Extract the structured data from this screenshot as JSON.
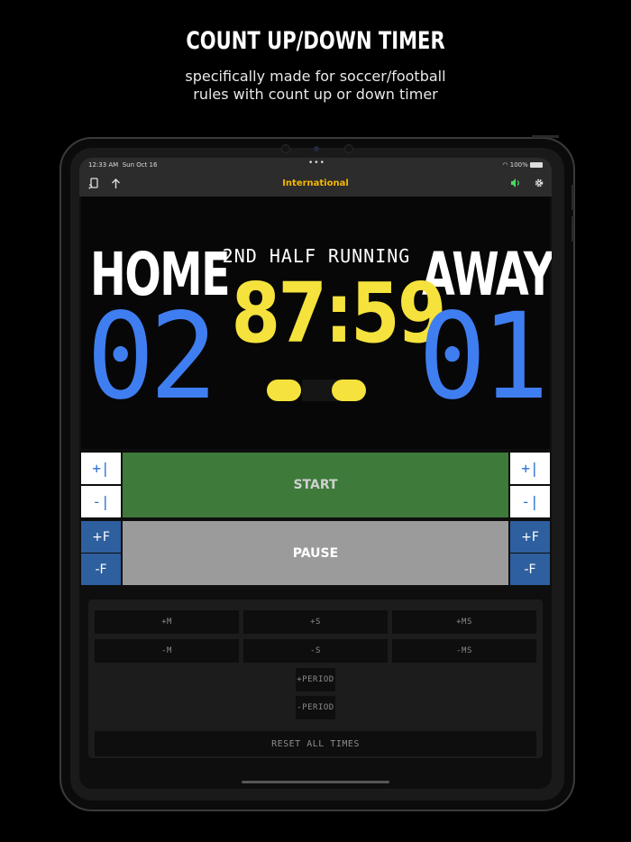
{
  "promo": {
    "title": "COUNT UP/DOWN TIMER",
    "subtitle_line1": "specifically made for soccer/football",
    "subtitle_line2": "rules with count up or down timer"
  },
  "status_bar": {
    "time": "12:33 AM",
    "date": "Sun Oct 16",
    "dots": "•••",
    "battery": "100%"
  },
  "nav": {
    "title": "International",
    "title_color": "#f5b800",
    "left_icons": [
      "cast-icon",
      "share-arrow-icon"
    ],
    "right_icons": [
      "speaker-icon",
      "gear-icon"
    ]
  },
  "scoreboard": {
    "home_label": "HOME",
    "away_label": "AWAY",
    "period_status": "2ND HALF RUNNING",
    "home_score": "02",
    "away_score": "01",
    "clock_minutes": "87",
    "clock_separator": ":",
    "clock_seconds": "59",
    "score_color": "#3f7ef0",
    "clock_color": "#f5e23c"
  },
  "controls": {
    "home_plus_point": "+|",
    "home_minus_point": "-|",
    "away_plus_point": "+|",
    "away_minus_point": "-|",
    "home_plus_foul": "+F",
    "home_minus_foul": "-F",
    "away_plus_foul": "+F",
    "away_minus_foul": "-F",
    "start_label": "START",
    "pause_label": "PAUSE",
    "start_color": "#3e7a3a",
    "pause_color": "#9b9b9b"
  },
  "time_panel": {
    "plus_minute": "+M",
    "plus_second": "+S",
    "plus_ms": "+MS",
    "minus_minute": "-M",
    "minus_second": "-S",
    "minus_ms": "-MS",
    "plus_period": "+PERIOD",
    "minus_period": "-PERIOD",
    "reset_all": "RESET ALL TIMES"
  }
}
